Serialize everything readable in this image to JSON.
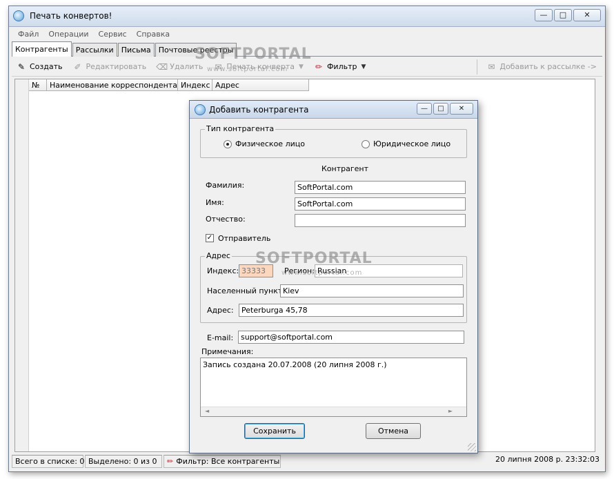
{
  "app": {
    "title": "Печать конвертов!",
    "window_buttons": {
      "minimize": "—",
      "maximize": "□",
      "close": "✕"
    }
  },
  "menu": [
    "Файл",
    "Операции",
    "Сервис",
    "Справка"
  ],
  "tabs": [
    "Контрагенты",
    "Рассылки",
    "Письма",
    "Почтовые реестры"
  ],
  "toolbar": {
    "create": "Создать",
    "edit": "Редактировать",
    "delete": "Удалить",
    "print": "Печать конверта",
    "filter": "Фильтр",
    "add_to_mailing": "Добавить к рассылке ->"
  },
  "grid": {
    "columns": [
      "№",
      "Наименование корреспондента",
      "Индекс",
      "Адрес"
    ]
  },
  "status": {
    "total": "Всего в списке: 0",
    "selected": "Выделено: 0 из 0",
    "filter": "Фильтр: Все контрагенты",
    "datetime": "20 липня 2008 р. 23:32:03"
  },
  "watermark": {
    "logo_top": "SOFTPORTAL",
    "url_top": "www.softportal.com",
    "logo_dialog": "SOFTPORTAL",
    "url_dialog": "www.softportal.com"
  },
  "dialog": {
    "title": "Добавить контрагента",
    "type_group": "Тип контрагента",
    "radio_person": "Физическое лицо",
    "radio_company": "Юридическое лицо",
    "section_title": "Контрагент",
    "surname_label": "Фамилия:",
    "surname_value": "SoftPortal.com",
    "name_label": "Имя:",
    "name_value": "SoftPortal.com",
    "patronymic_label": "Отчество:",
    "patronymic_value": "",
    "sender_label": "Отправитель",
    "sender_checked": "✓",
    "address_group": "Адрес",
    "index_label": "Индекс:",
    "index_value": "33333",
    "region_label": "Регион:",
    "region_value": "Russian",
    "locality_label": "Населенный пункт:",
    "locality_value": "Kiev",
    "address_label": "Адрес:",
    "address_value": "Peterburga 45,78",
    "email_label": "E-mail:",
    "email_value": "support@softportal.com",
    "notes_label": "Примечания:",
    "notes_value": "Запись создана 20.07.2008 (20 липня 2008 г.)",
    "save_button": "Сохранить",
    "cancel_button": "Отмена",
    "scroll_left": "◄",
    "scroll_right": "►"
  }
}
